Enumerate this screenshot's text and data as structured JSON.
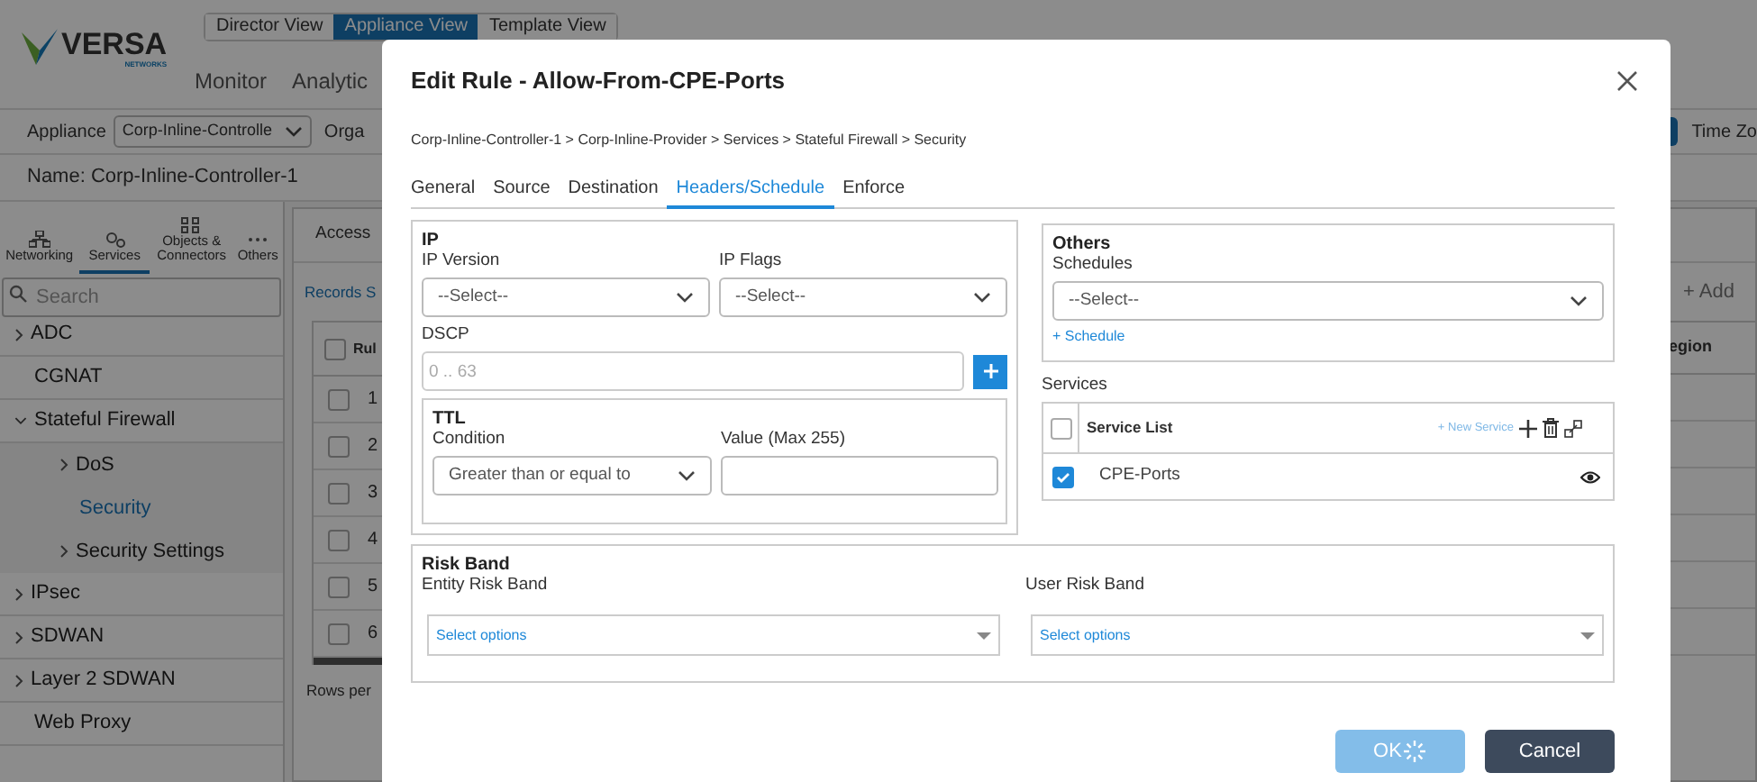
{
  "app": {
    "logo": {
      "name": "VERSA",
      "tagline": "NETWORKS"
    },
    "view_toggle": [
      {
        "label": "Director View",
        "selected": false
      },
      {
        "label": "Appliance View",
        "selected": true
      },
      {
        "label": "Template View",
        "selected": false
      }
    ],
    "menu": [
      "Monitor",
      "Analytic"
    ],
    "appliance": {
      "label": "Appliance",
      "value": "Corp-Inline-Controlle",
      "org_label": "Orga"
    },
    "time_zone": "Time Zo",
    "name_bar": "Name: Corp-Inline-Controller-1",
    "sidebar": {
      "tabs": [
        {
          "label": "Networking",
          "kind": "network",
          "selected": false
        },
        {
          "label": "Services",
          "kind": "gears",
          "selected": true
        },
        {
          "label": "Objects & Connectors",
          "kind": "grid",
          "selected": false
        },
        {
          "label": "Others",
          "kind": "dots",
          "selected": false
        }
      ],
      "search": {
        "placeholder": "Search"
      },
      "tree": [
        {
          "label": "ADC",
          "kind": "group",
          "expanded": false,
          "selected": false
        },
        {
          "label": "CGNAT",
          "kind": "leaf",
          "selected": false
        },
        {
          "label": "Stateful Firewall",
          "kind": "group",
          "expanded": true,
          "selected": false,
          "children": [
            {
              "label": "DoS",
              "kind": "group",
              "expanded": false,
              "selected": false
            },
            {
              "label": "Security",
              "kind": "leaf",
              "selected": true
            },
            {
              "label": "Security Settings",
              "kind": "group",
              "expanded": false,
              "selected": false
            }
          ]
        },
        {
          "label": "IPsec",
          "kind": "group",
          "expanded": false,
          "selected": false
        },
        {
          "label": "SDWAN",
          "kind": "group",
          "expanded": false,
          "selected": false
        },
        {
          "label": "Layer 2 SDWAN",
          "kind": "group",
          "expanded": false,
          "selected": false
        },
        {
          "label": "Web Proxy",
          "kind": "leaf",
          "selected": false
        }
      ]
    },
    "main": {
      "tab": "Access",
      "records": "Records S",
      "add": "+ Add",
      "header_checked": false,
      "column_1": "Rul",
      "column_region": "egion",
      "rows": [
        {
          "cell": "1",
          "checked": false
        },
        {
          "cell": "2",
          "checked": false
        },
        {
          "cell": "3",
          "checked": false
        },
        {
          "cell": "4",
          "checked": false
        },
        {
          "cell": "5",
          "checked": false
        },
        {
          "cell": "6",
          "checked": false
        }
      ],
      "footer": "Rows per"
    }
  },
  "modal": {
    "title": "Edit Rule - Allow-From-CPE-Ports",
    "breadcrumb": "Corp-Inline-Controller-1 > Corp-Inline-Provider > Services > Stateful Firewall > Security",
    "tabs": [
      {
        "label": "General",
        "selected": false
      },
      {
        "label": "Source",
        "selected": false
      },
      {
        "label": "Destination",
        "selected": false
      },
      {
        "label": "Headers/Schedule",
        "selected": true
      },
      {
        "label": "Enforce",
        "selected": false
      }
    ],
    "ip": {
      "heading": "IP",
      "ip_version": {
        "label": "IP Version",
        "value": "--Select--"
      },
      "ip_flags": {
        "label": "IP Flags",
        "value": "--Select--"
      },
      "dscp": {
        "label": "DSCP",
        "placeholder": "0 .. 63"
      },
      "ttl": {
        "heading": "TTL",
        "condition": {
          "label": "Condition",
          "value": "Greater than or equal to"
        },
        "value": {
          "label": "Value (Max 255)"
        }
      }
    },
    "others": {
      "heading": "Others",
      "schedules": {
        "label": "Schedules",
        "value": "--Select--"
      },
      "add_link": "+ Schedule"
    },
    "services": {
      "label": "Services",
      "header": {
        "checked": false,
        "title": "Service List",
        "new_link": "+ New Service"
      },
      "rows": [
        {
          "name": "CPE-Ports",
          "checked": true
        }
      ]
    },
    "risk_band": {
      "heading": "Risk Band",
      "entity": {
        "label": "Entity Risk Band",
        "placeholder": "Select options"
      },
      "user": {
        "label": "User Risk Band",
        "placeholder": "Select options"
      }
    },
    "buttons": [
      {
        "label": "OK",
        "kind": "primary",
        "loading": true
      },
      {
        "label": "Cancel",
        "kind": "secondary",
        "loading": false
      }
    ]
  }
}
